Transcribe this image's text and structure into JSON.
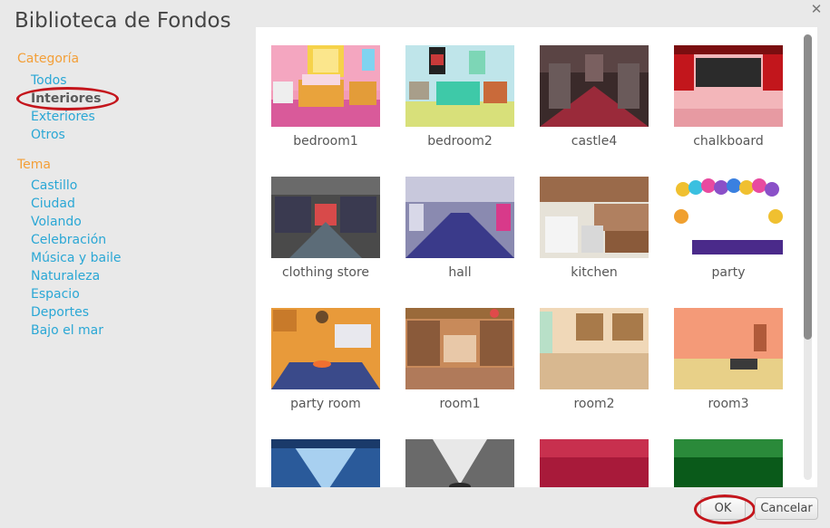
{
  "dialog": {
    "title": "Biblioteca de Fondos",
    "close_icon": "close-icon",
    "ok_label": "OK",
    "cancel_label": "Cancelar"
  },
  "sidebar": {
    "category_title": "Categoría",
    "categories": [
      {
        "label": "Todos"
      },
      {
        "label": "Interiores",
        "selected": true
      },
      {
        "label": "Exteriores"
      },
      {
        "label": "Otros"
      }
    ],
    "theme_title": "Tema",
    "themes": [
      {
        "label": "Castillo"
      },
      {
        "label": "Ciudad"
      },
      {
        "label": "Volando"
      },
      {
        "label": "Celebración"
      },
      {
        "label": "Música y baile"
      },
      {
        "label": "Naturaleza"
      },
      {
        "label": "Espacio"
      },
      {
        "label": "Deportes"
      },
      {
        "label": "Bajo el mar"
      }
    ]
  },
  "backdrops": [
    {
      "name": "bedroom1"
    },
    {
      "name": "bedroom2"
    },
    {
      "name": "castle4"
    },
    {
      "name": "chalkboard"
    },
    {
      "name": "clothing store"
    },
    {
      "name": "hall"
    },
    {
      "name": "kitchen"
    },
    {
      "name": "party"
    },
    {
      "name": "party room"
    },
    {
      "name": "room1"
    },
    {
      "name": "room2"
    },
    {
      "name": "room3"
    },
    {
      "name": ""
    },
    {
      "name": ""
    },
    {
      "name": ""
    },
    {
      "name": ""
    }
  ],
  "colors": {
    "accent_orange": "#f39f38",
    "link_blue": "#2aa7d5",
    "annotation_red": "#c4151c"
  }
}
